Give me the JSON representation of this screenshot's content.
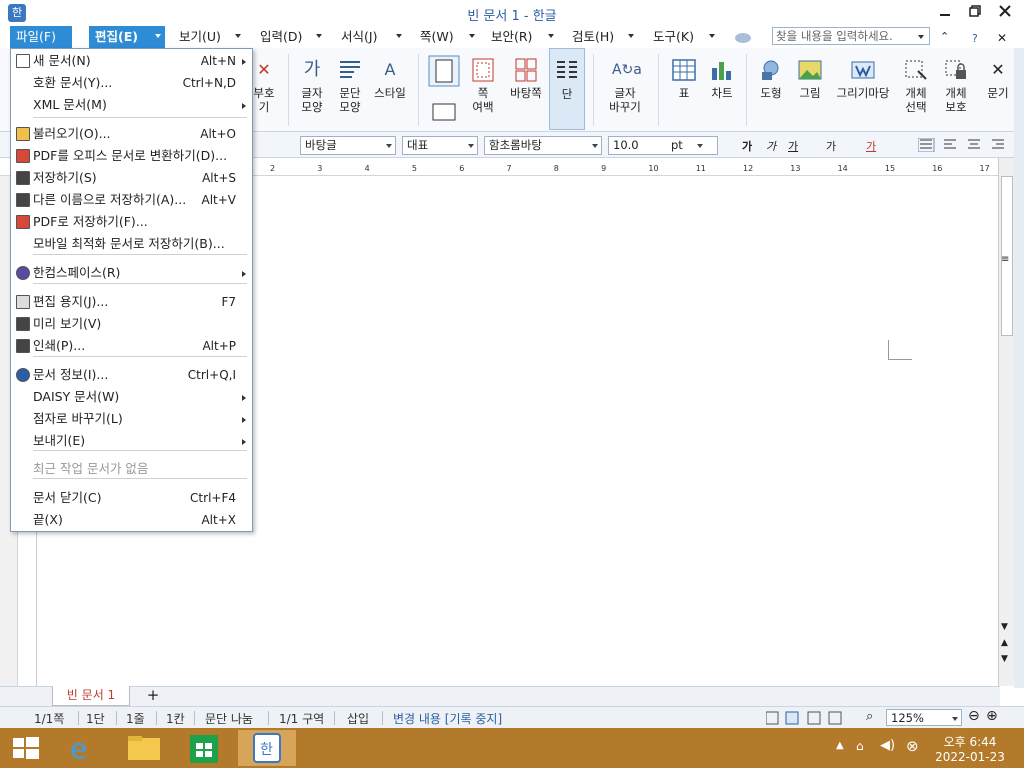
{
  "window": {
    "title": "빈 문서 1 - 한글",
    "app_icon": "한"
  },
  "menubar": {
    "items": [
      {
        "label": "파일(F)"
      },
      {
        "label": "편집(E)"
      },
      {
        "label": "보기(U)"
      },
      {
        "label": "입력(D)"
      },
      {
        "label": "서식(J)"
      },
      {
        "label": "쪽(W)"
      },
      {
        "label": "보안(R)"
      },
      {
        "label": "검토(H)"
      },
      {
        "label": "도구(K)"
      }
    ],
    "search_placeholder": "찾을 내용을 입력하세요."
  },
  "toolbar": {
    "buttons": [
      {
        "label": "부호\n기",
        "icon": "symbol-icon"
      },
      {
        "label": "글자\n모양",
        "icon": "char-shape-icon"
      },
      {
        "label": "문단\n모양",
        "icon": "paragraph-shape-icon"
      },
      {
        "label": "스타일",
        "icon": "style-icon"
      },
      {
        "label": "쪽\n여백",
        "icon": "margin-icon"
      },
      {
        "label": "바탕쪽",
        "icon": "master-page-icon"
      },
      {
        "label": "단",
        "icon": "column-icon"
      },
      {
        "label": "글자\n바꾸기",
        "icon": "change-char-icon"
      },
      {
        "label": "표",
        "icon": "table-icon"
      },
      {
        "label": "차트",
        "icon": "chart-icon"
      },
      {
        "label": "도형",
        "icon": "shape-icon"
      },
      {
        "label": "그림",
        "icon": "picture-icon"
      },
      {
        "label": "그리기마당",
        "icon": "drawing-gallery-icon"
      },
      {
        "label": "개체\n선택",
        "icon": "object-select-icon"
      },
      {
        "label": "개체\n보호",
        "icon": "object-protect-icon"
      },
      {
        "label": "문기",
        "icon": "more-icon"
      }
    ]
  },
  "formatbar": {
    "style": "바탕글",
    "lang": "대표",
    "font": "함초롬바탕",
    "size": "10.0",
    "unit": "pt",
    "font_style_glyphs": [
      "가",
      "가",
      "가",
      "가",
      "가"
    ]
  },
  "ruler": {
    "ticks": [
      "2",
      "3",
      "4",
      "5",
      "6",
      "7",
      "8",
      "9",
      "10",
      "11",
      "12",
      "13",
      "14",
      "15",
      "16",
      "17"
    ]
  },
  "file_menu": {
    "items": [
      {
        "label": "새 문서(N)",
        "shortcut": "Alt+N",
        "submenu": true,
        "icon": "new-document-icon"
      },
      {
        "label": "호환 문서(Y)...",
        "shortcut": "Ctrl+N,D",
        "icon": ""
      },
      {
        "label": "XML 문서(M)",
        "shortcut": "",
        "submenu": true,
        "icon": ""
      },
      {
        "label": "불러오기(O)...",
        "shortcut": "Alt+O",
        "icon": "open-folder-icon"
      },
      {
        "label": "PDF를 오피스 문서로 변환하기(D)...",
        "shortcut": "",
        "icon": "pdf-convert-icon"
      },
      {
        "label": "저장하기(S)",
        "shortcut": "Alt+S",
        "icon": "save-icon"
      },
      {
        "label": "다른 이름으로 저장하기(A)...",
        "shortcut": "Alt+V",
        "icon": "save-as-icon"
      },
      {
        "label": "PDF로 저장하기(F)...",
        "shortcut": "",
        "icon": "save-pdf-icon"
      },
      {
        "label": "모바일 최적화 문서로 저장하기(B)...",
        "shortcut": "",
        "icon": ""
      },
      {
        "label": "한컴스페이스(R)",
        "shortcut": "",
        "submenu": true,
        "icon": "hancom-space-icon"
      },
      {
        "label": "편집 용지(J)...",
        "shortcut": "F7",
        "icon": "page-setup-icon"
      },
      {
        "label": "미리 보기(V)",
        "shortcut": "",
        "icon": "preview-icon"
      },
      {
        "label": "인쇄(P)...",
        "shortcut": "Alt+P",
        "icon": "print-icon"
      },
      {
        "label": "문서 정보(I)...",
        "shortcut": "Ctrl+Q,I",
        "icon": "info-icon"
      },
      {
        "label": "DAISY 문서(W)",
        "shortcut": "",
        "submenu": true,
        "icon": ""
      },
      {
        "label": "점자로 바꾸기(L)",
        "shortcut": "",
        "submenu": true,
        "icon": ""
      },
      {
        "label": "보내기(E)",
        "shortcut": "",
        "submenu": true,
        "icon": ""
      },
      {
        "label": "최근 작업 문서가 없음",
        "shortcut": "",
        "disabled": true,
        "icon": ""
      },
      {
        "label": "문서 닫기(C)",
        "shortcut": "Ctrl+F4",
        "icon": ""
      },
      {
        "label": "끝(X)",
        "shortcut": "Alt+X",
        "icon": ""
      }
    ]
  },
  "tabs": {
    "doc_tab": "빈 문서 1",
    "add": "+"
  },
  "status": {
    "page": "1/1쪽",
    "col": "1단",
    "line": "1줄",
    "char": "1칸",
    "break": "문단 나눔",
    "section": "1/1 구역",
    "mode": "삽입",
    "track": "변경 내용 [기록 중지]",
    "zoom": "125%"
  },
  "taskbar": {
    "time": "오후 6:44",
    "date": "2022-01-23"
  }
}
